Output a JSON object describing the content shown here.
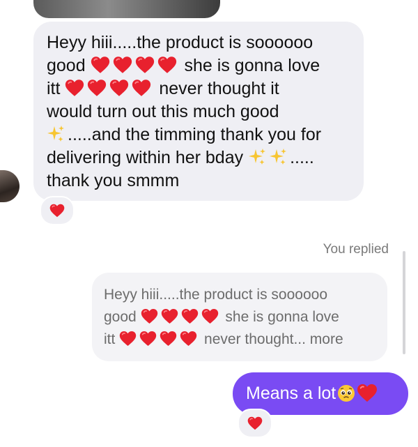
{
  "conversation": {
    "incoming": {
      "lines": [
        [
          "Heyy hiii.....the product is soooooo"
        ],
        [
          "good",
          "she is gonna love"
        ],
        [
          "itt",
          "never thought it"
        ],
        [
          "would turn out this much good"
        ],
        [
          ".....and the timming thank you for"
        ],
        [
          "delivering within her bday",
          "....."
        ],
        [
          "thank you smmm"
        ]
      ],
      "reaction": "red-heart"
    },
    "status": "You replied",
    "quoted_reply": {
      "line1": "Heyy hiii.....the product is soooooo",
      "line2_a": "good",
      "line2_b": "she is gonna love",
      "line3_a": "itt",
      "line3_b": "never thought... more"
    },
    "outgoing": {
      "text": "Means a lot",
      "emojis": [
        "pleading-face",
        "red-heart"
      ],
      "reaction": "red-heart"
    },
    "colors": {
      "incoming_bubble": "#efeff4",
      "outgoing_bubble": "#7a4bf3",
      "heart": "#e8212e"
    }
  }
}
